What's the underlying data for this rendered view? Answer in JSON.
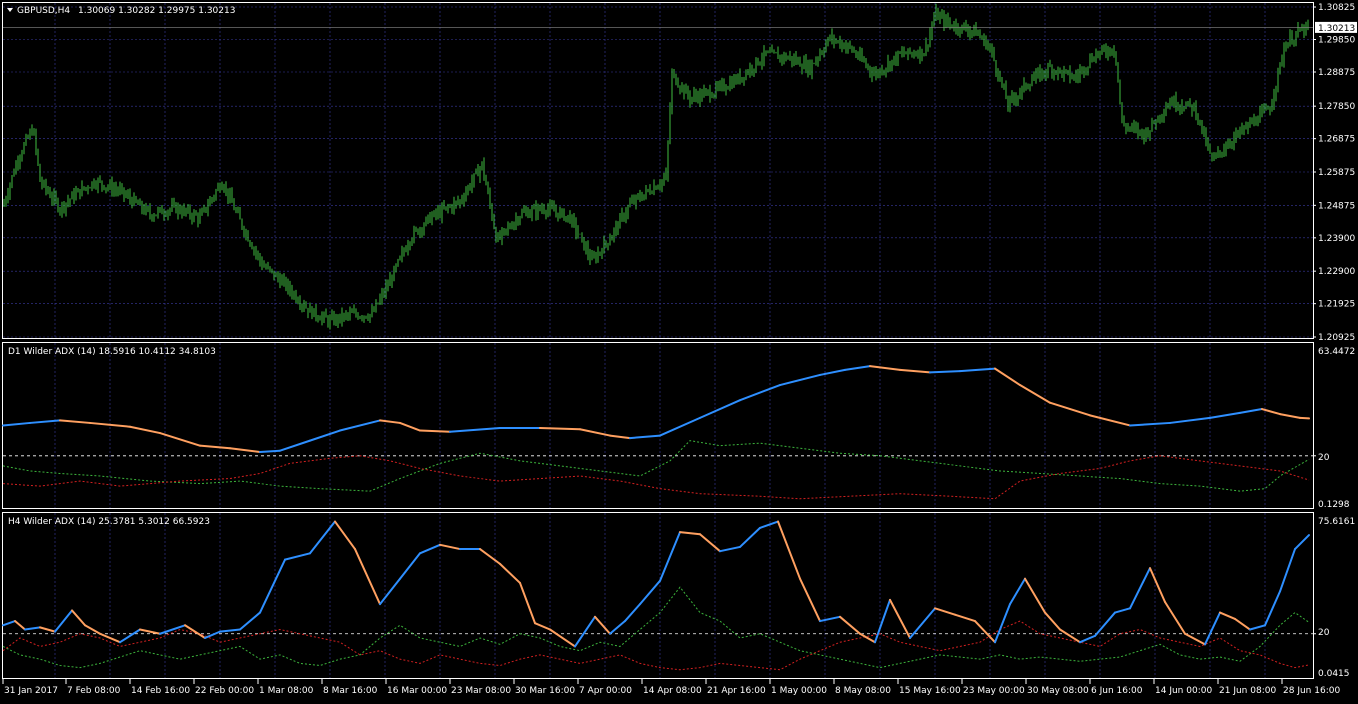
{
  "main": {
    "symbol": "GBPUSD,H4",
    "ohlc": "1.30069 1.30282 1.29975 1.30213",
    "current_price": "1.30213",
    "price_labels": [
      "1.30825",
      "1.29850",
      "1.28875",
      "1.27850",
      "1.26875",
      "1.25875",
      "1.24875",
      "1.23900",
      "1.22900",
      "1.21925",
      "1.20925"
    ],
    "price_range": [
      1.20925,
      1.30825
    ],
    "bar_color": "#3fbe3f"
  },
  "adx_d1": {
    "title": "D1 Wilder ADX (14) 18.5916 10.4112 34.8103",
    "labels": [
      "63.4472",
      "20",
      "0.1298"
    ],
    "range": [
      0.1298,
      63.4472
    ],
    "level": 20
  },
  "adx_h4": {
    "title": "H4 Wilder ADX (14) 25.3781 5.3012 66.5923",
    "labels": [
      "75.6161",
      "20",
      "0.0415"
    ],
    "range": [
      0.0415,
      75.6161
    ],
    "level": 20
  },
  "colors": {
    "adx_rising": "#2e8fff",
    "adx_falling": "#ffa060",
    "plus_di": "#3cb43c",
    "minus_di": "#d22020",
    "grid": "#3a3aa0",
    "background": "#000000"
  },
  "time_axis": [
    "31 Jan 2017",
    "7 Feb 08:00",
    "14 Feb 16:00",
    "22 Feb 00:00",
    "1 Mar 08:00",
    "8 Mar 16:00",
    "16 Mar 00:00",
    "23 Mar 08:00",
    "30 Mar 16:00",
    "7 Apr 00:00",
    "14 Apr 08:00",
    "21 Apr 16:00",
    "1 May 00:00",
    "8 May 08:00",
    "15 May 16:00",
    "23 May 00:00",
    "30 May 08:00",
    "6 Jun 16:00",
    "14 Jun 00:00",
    "21 Jun 08:00",
    "28 Jun 16:00"
  ]
}
